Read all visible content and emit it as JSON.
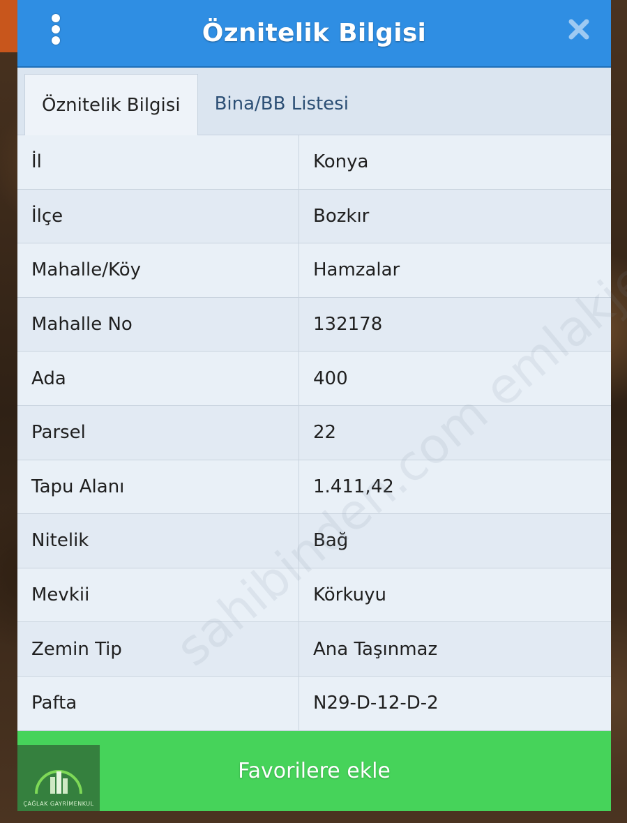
{
  "dialog": {
    "title": "Öznitelik Bilgisi",
    "tabs": [
      {
        "label": "Öznitelik Bilgisi",
        "active": true
      },
      {
        "label": "Bina/BB Listesi",
        "active": false
      }
    ],
    "rows": [
      {
        "key": "İl",
        "value": "Konya"
      },
      {
        "key": "İlçe",
        "value": "Bozkır"
      },
      {
        "key": "Mahalle/Köy",
        "value": "Hamzalar"
      },
      {
        "key": "Mahalle No",
        "value": "132178"
      },
      {
        "key": "Ada",
        "value": "400"
      },
      {
        "key": "Parsel",
        "value": "22"
      },
      {
        "key": "Tapu Alanı",
        "value": "1.411,42"
      },
      {
        "key": "Nitelik",
        "value": "Bağ"
      },
      {
        "key": "Mevkii",
        "value": "Körkuyu"
      },
      {
        "key": "Zemin Tip",
        "value": "Ana Taşınmaz"
      },
      {
        "key": "Pafta",
        "value": "N29-D-12-D-2"
      }
    ],
    "favorite_button": "Favorilere ekle"
  },
  "logo": {
    "text": "ÇAĞLAK GAYRİMENKUL"
  },
  "watermark": "sahibinden.com emlakjet.com",
  "colors": {
    "header": "#2f8ee3",
    "favorite": "#46d35a",
    "panel": "#e6eef7"
  },
  "icons": {
    "menu": "kebab-menu-icon",
    "close": "close-icon"
  }
}
